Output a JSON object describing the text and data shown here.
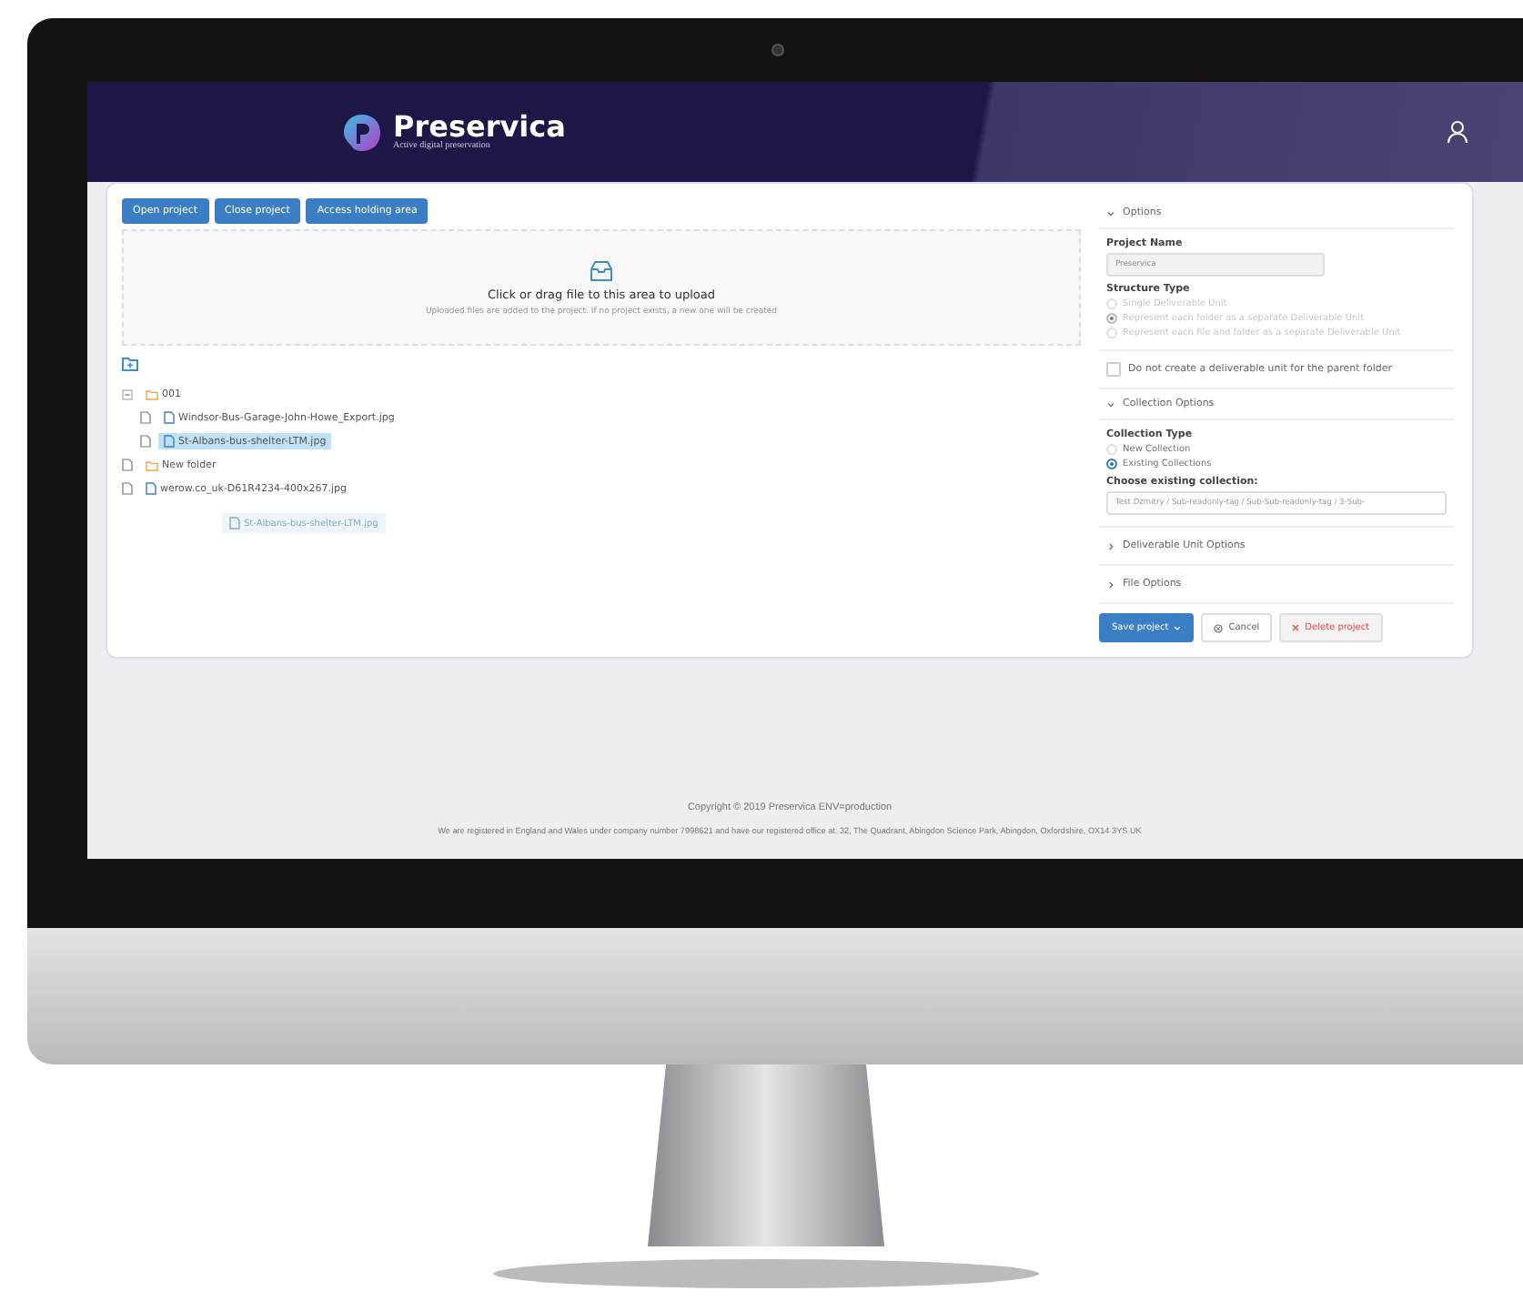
{
  "header": {
    "brand": "Preservica",
    "tagline": "Active digital preservation"
  },
  "toolbar": {
    "buttons": [
      "Open project",
      "Close project",
      "Access holding area"
    ]
  },
  "upload": {
    "title": "Click or drag file to this area to upload",
    "hint": "Uploaded files are added to the project. If no project exists, a new one will be created"
  },
  "tree": [
    {
      "kind": "folder",
      "label": "001",
      "expanded": true,
      "selected": false,
      "children": [
        {
          "kind": "file",
          "label": "Windsor-Bus-Garage-John-Howe_Export.jpg",
          "selected": false
        },
        {
          "kind": "file",
          "label": "St-Albans-bus-shelter-LTM.jpg",
          "selected": true
        }
      ]
    },
    {
      "kind": "folder",
      "label": "New folder",
      "selected": false
    },
    {
      "kind": "file",
      "label": "werow.co_uk-D61R4234-400x267.jpg",
      "selected": false
    }
  ],
  "drag_ghost": {
    "label": "St-Albans-bus-shelter-LTM.jpg"
  },
  "options": {
    "title": "Options",
    "expanded": true,
    "project_name_label": "Project Name",
    "project_name": "Preservica",
    "structure_label": "Structure Type",
    "structure_disabled": true,
    "structure_options": [
      {
        "label": "Single Deliverable Unit",
        "selected": false
      },
      {
        "label": "Represent each folder as a separate Deliverable Unit",
        "selected": true
      },
      {
        "label": "Represent each file and folder as a separate Deliverable Unit",
        "selected": false
      }
    ],
    "parent_checkbox": {
      "label": "Do not create a deliverable unit for the parent folder",
      "checked": false
    }
  },
  "collection": {
    "title": "Collection Options",
    "expanded": true,
    "type_label": "Collection Type",
    "types": [
      {
        "label": "New Collection",
        "selected": false
      },
      {
        "label": "Existing Collections",
        "selected": true
      }
    ],
    "choose_label": "Choose existing collection:",
    "value": "Test Dzmitry / Sub-readonly-tag / Sub-Sub-readonly-tag / 3-Sub-"
  },
  "sections": [
    {
      "title": "Deliverable Unit Options",
      "expanded": false
    },
    {
      "title": "File Options",
      "expanded": false
    }
  ],
  "actions": [
    {
      "kind": "primary",
      "label": "Save project"
    },
    {
      "kind": "default",
      "label": "Cancel"
    },
    {
      "kind": "danger",
      "label": "Delete project"
    }
  ],
  "footer": {
    "copyright": "Copyright © 2019 Preservica ENV=production",
    "address": "We are registered in England and Wales under company number 7998621 and have our registered office at: 32, The Quadrant, Abingdon Science Park, Abingdon, Oxfordshire, OX14 3YS UK"
  }
}
